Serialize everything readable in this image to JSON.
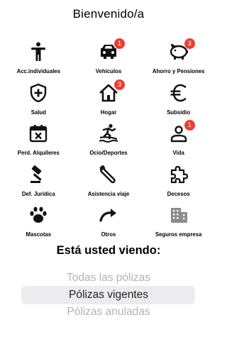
{
  "header": {
    "title": "Bienvenido/a"
  },
  "tiles": [
    {
      "label": "Acc.individuales",
      "icon": "person-icon",
      "badge": ""
    },
    {
      "label": "Vehículos",
      "icon": "car-icon",
      "badge": "1"
    },
    {
      "label": "Ahorro y Pensiones",
      "icon": "piggy-bank-icon",
      "badge": "3"
    },
    {
      "label": "Salud",
      "icon": "shield-plus-icon",
      "badge": ""
    },
    {
      "label": "Hogar",
      "icon": "home-icon",
      "badge": "3"
    },
    {
      "label": "Subsidio",
      "icon": "euro-icon",
      "badge": ""
    },
    {
      "label": "Perd. Alquileres",
      "icon": "calendar-x-icon",
      "badge": ""
    },
    {
      "label": "Ocio/Deportes",
      "icon": "surfer-icon",
      "badge": ""
    },
    {
      "label": "Vida",
      "icon": "user-icon",
      "badge": "1"
    },
    {
      "label": "Def. Jurídica",
      "icon": "gavel-icon",
      "badge": ""
    },
    {
      "label": "Asistencia viaje",
      "icon": "wrench-icon",
      "badge": ""
    },
    {
      "label": "Decesos",
      "icon": "puzzle-icon",
      "badge": ""
    },
    {
      "label": "Mascotas",
      "icon": "paw-icon",
      "badge": ""
    },
    {
      "label": "Otros",
      "icon": "curved-arrow-icon",
      "badge": ""
    },
    {
      "label": "Seguros empresa",
      "icon": "building-icon",
      "badge": ""
    }
  ],
  "viewing": {
    "title": "Está usted viendo:",
    "options": [
      "Todas las pólizas",
      "Pólizas vigentes",
      "Pólizas anuladas"
    ],
    "selected": "Pólizas vigentes"
  },
  "colors": {
    "badge": "#ee3d2f",
    "icon": "#111111",
    "muted_icon": "#8c8c8c",
    "picker_highlight": "#ececee"
  }
}
